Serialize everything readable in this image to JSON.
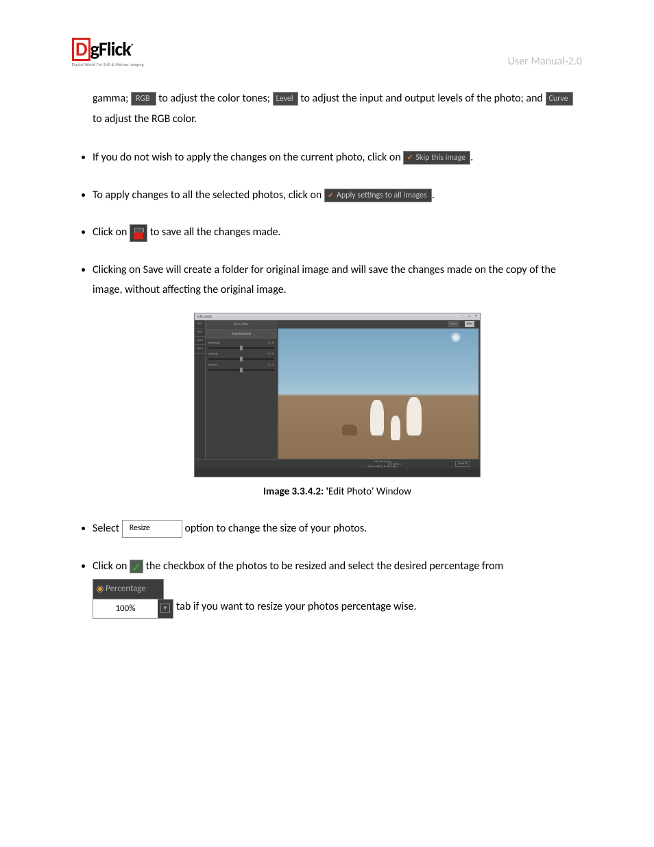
{
  "header": {
    "logo_main": "DgFlick",
    "logo_tag": "Digital World For Still & Motion Imaging",
    "right": "User Manual-2.0"
  },
  "para1": {
    "t1": "gamma; ",
    "btn_rgb": "RGB",
    "t2": " to adjust the color tones; ",
    "btn_level": "Level",
    "t3": " to adjust the input and output levels of the photo; and ",
    "btn_curve": "Curve",
    "t4": " to adjust the RGB color."
  },
  "bullets": {
    "b1_a": "If you do not wish to apply the changes on the current photo, click on",
    "b1_btn": "Skip this image",
    "b1_b": ".",
    "b2_a": "To apply changes to all the selected photos, click on",
    "b2_btn": "Apply settings to all images",
    "b2_b": ".",
    "b3_a": "Click on ",
    "b3_b": " to save all the changes made.",
    "b4": "Clicking on Save will create a folder for original image and will save the changes made on the copy of the image, without affecting the original image.",
    "b5_a": "Select ",
    "b5_btn": "Resize",
    "b5_b": " option to change the size of your photos.",
    "b6_a": "Click on ",
    "b6_b": " the checkbox of the photos to be resized and select the desired percentage from ",
    "b6_perc_label": "Percentage",
    "b6_perc_value": "100%",
    "b6_c": " tab if you want to resize your photos percentage wise."
  },
  "figure": {
    "caption_bold": "Image 3.3.4.2: '",
    "caption_rest": "Edit Photo' Window",
    "window_title": "Edit photo",
    "nav": {
      "i1": "BCG",
      "i2": "RGB",
      "i3": "Level",
      "i4": "Curve"
    },
    "panel_tab": "Basic Filter",
    "panel_sub": "Auto Contrast",
    "sliders": {
      "s1": "Brightness",
      "s2": "Contrast",
      "s3": "Gamma"
    },
    "before": "Before",
    "after": "After",
    "opt1": "Skip this image",
    "opt2": "Apply settings to all images",
    "nav_pager": "1  1 of 1  1",
    "reset": "Reset all"
  }
}
